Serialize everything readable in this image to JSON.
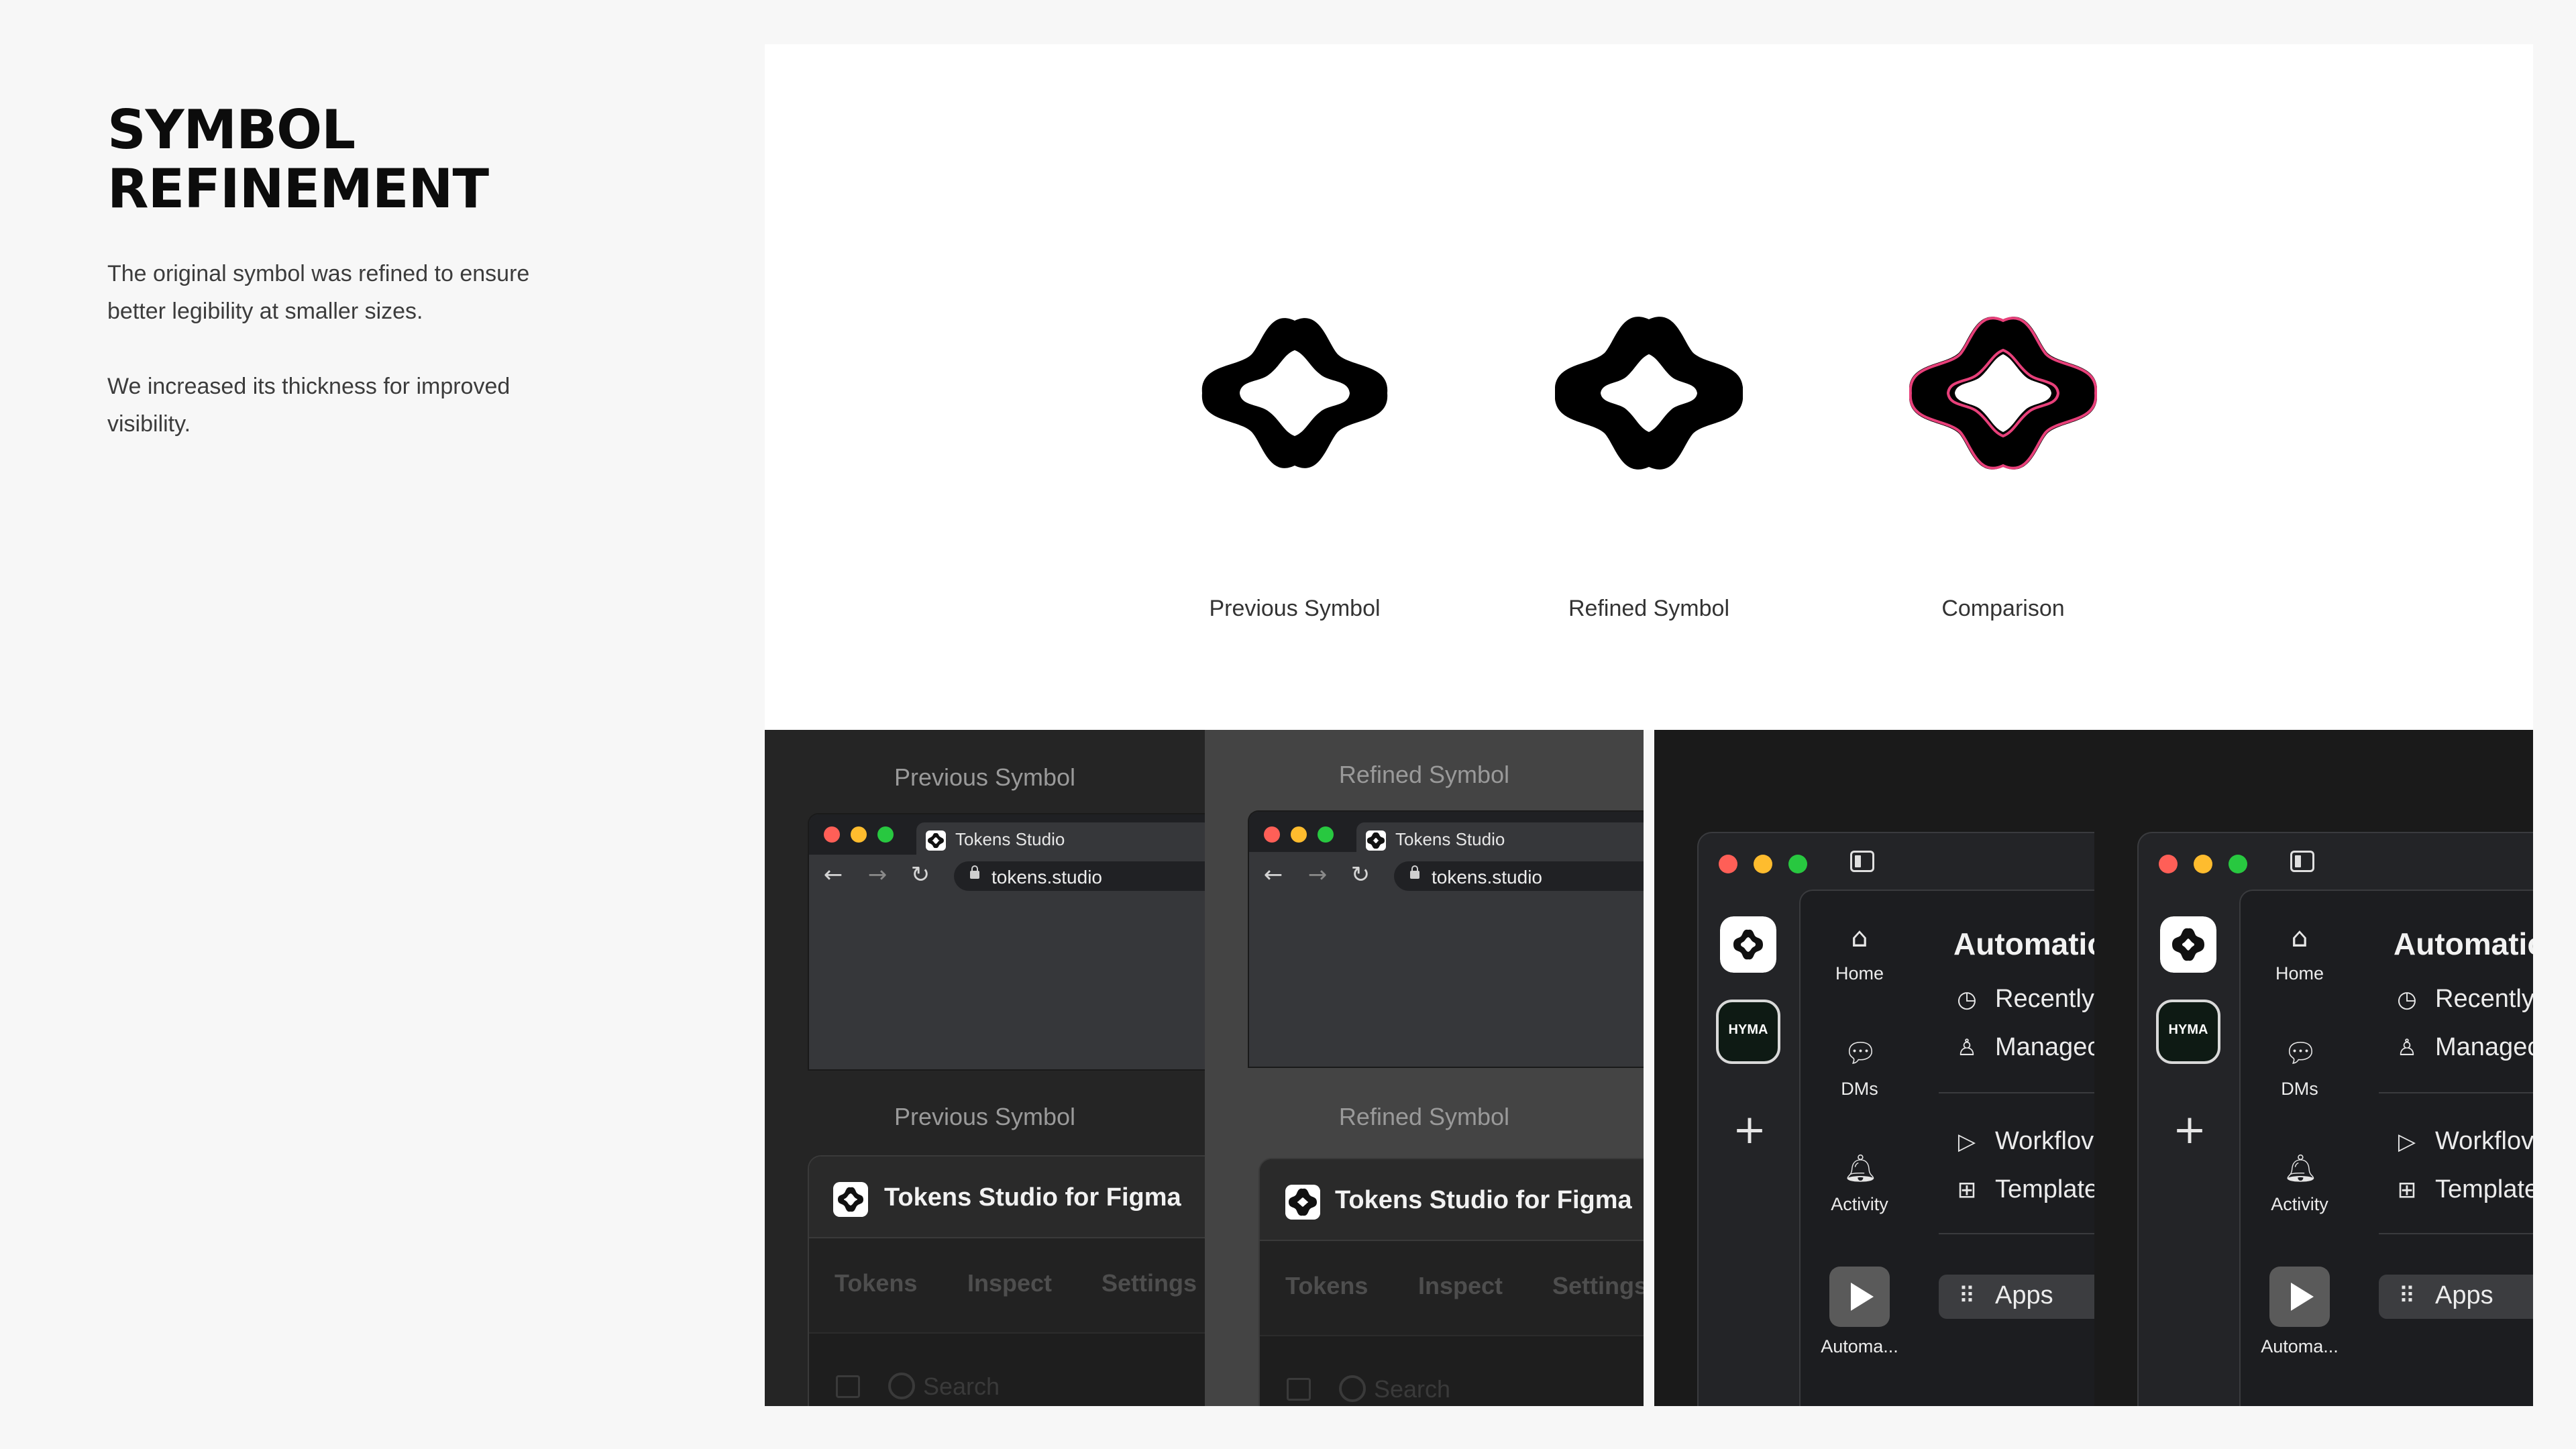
{
  "header": {
    "title_line1": "SYMBOL",
    "title_line2": "REFINEMENT",
    "paragraph1": "The original symbol was refined to ensure better legibility at smaller sizes.",
    "paragraph2": "We increased its thickness for improved visibility."
  },
  "symbols": {
    "previous_label": "Previous Symbol",
    "refined_label": "Refined Symbol",
    "comparison_label": "Comparison"
  },
  "colors": {
    "comparison_outline": "#e8407a",
    "traffic_red": "#ff5f57",
    "traffic_yellow": "#febc2e",
    "traffic_green": "#28c840"
  },
  "browser_mockups": {
    "previous_label": "Previous Symbol",
    "refined_label": "Refined Symbol",
    "tab_title": "Tokens Studio",
    "url": "tokens.studio",
    "back_icon": "arrow-left-icon",
    "forward_icon": "arrow-right-icon",
    "reload_icon": "reload-icon"
  },
  "plugin_mockups": {
    "previous_label": "Previous Symbol",
    "refined_label": "Refined Symbol",
    "title": "Tokens Studio for Figma",
    "tabs": [
      "Tokens",
      "Inspect",
      "Settings"
    ],
    "search_placeholder": "Search"
  },
  "app_mockups": {
    "workspace_badge": "HYMA",
    "nav": [
      "Home",
      "DMs",
      "Activity",
      "Automa..."
    ],
    "content_title": "Automatio",
    "items": [
      "Recently",
      "Managec",
      "Workflov",
      "Template"
    ],
    "apps_label": "Apps"
  }
}
